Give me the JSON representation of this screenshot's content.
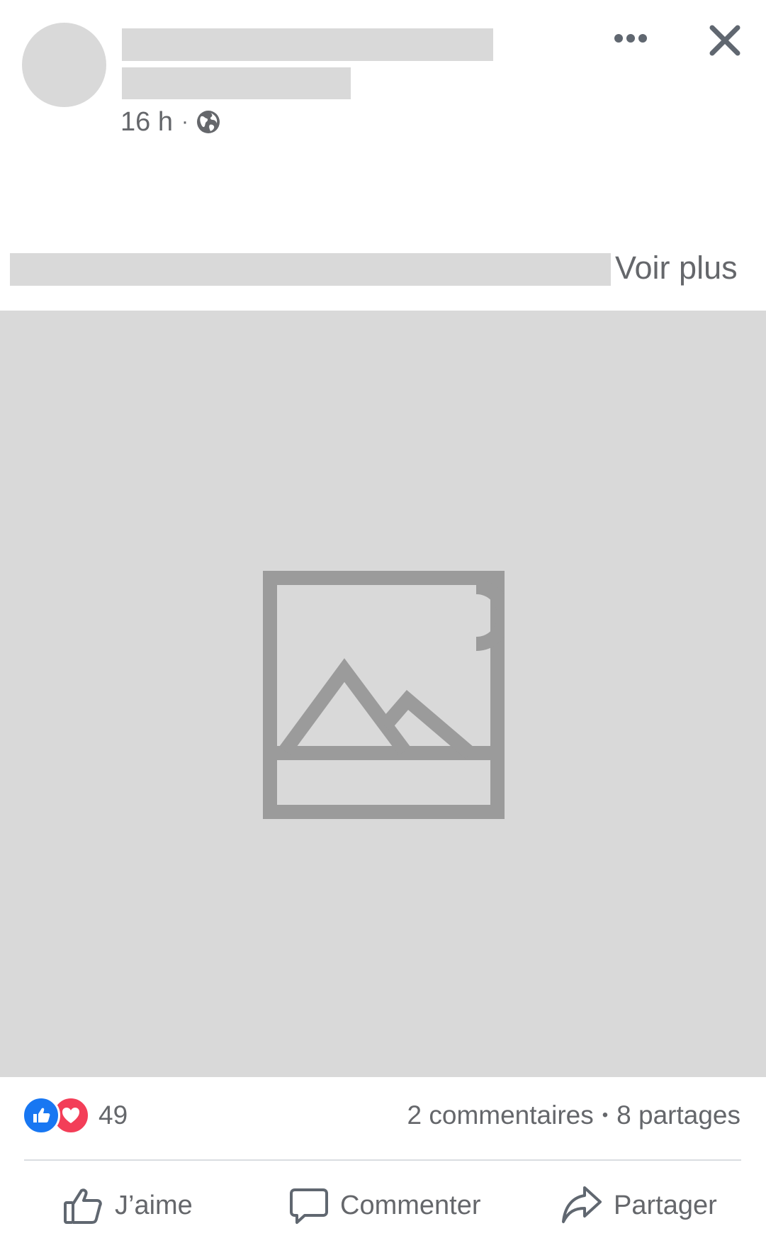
{
  "post": {
    "time": "16 h",
    "separator": "·",
    "audience_icon": "globe-icon",
    "see_more": "Voir plus"
  },
  "header_actions": {
    "more_icon": "more-options-icon",
    "close_icon": "close-icon"
  },
  "media": {
    "placeholder_icon": "image-placeholder-icon"
  },
  "reactions": {
    "icons": [
      "like-reaction-icon",
      "love-reaction-icon"
    ],
    "count": "49",
    "comments": "2 commentaires",
    "dot": "•",
    "shares": "8 partages"
  },
  "actions": {
    "like": "J’aime",
    "comment": "Commenter",
    "share": "Partager"
  },
  "colors": {
    "placeholder_gray": "#d9d9d9",
    "icon_gray": "#9b9b9b",
    "text_gray": "#65676b",
    "like_blue": "#1877f2",
    "love_red": "#f33e58"
  }
}
